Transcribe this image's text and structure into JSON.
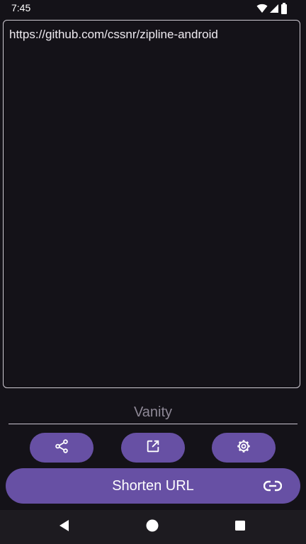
{
  "status_bar": {
    "time": "7:45"
  },
  "url_box": {
    "value": "https://github.com/cssnr/zipline-android"
  },
  "vanity": {
    "placeholder": "Vanity"
  },
  "actions": {
    "share_icon": "share-icon",
    "open_icon": "open-in-new-icon",
    "settings_icon": "gear-icon"
  },
  "shorten_button": {
    "label": "Shorten URL",
    "icon": "link-icon"
  },
  "colors": {
    "background": "#141218",
    "accent": "#6750a4",
    "text": "#e6e1e5"
  }
}
